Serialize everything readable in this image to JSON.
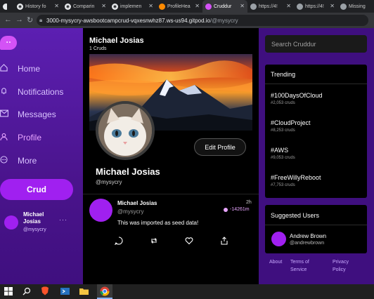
{
  "browser": {
    "tabs": [
      {
        "title": "History fo",
        "icon": "github-icon"
      },
      {
        "title": "Comparin",
        "icon": "github-icon"
      },
      {
        "title": "implemen",
        "icon": "github-icon"
      },
      {
        "title": "ProfileHea",
        "icon": "gitpod-icon"
      },
      {
        "title": "Cruddur",
        "icon": "cruddur-icon",
        "active": true
      },
      {
        "title": "https://4!",
        "icon": "globe-icon"
      },
      {
        "title": "https://4!",
        "icon": "globe-icon"
      },
      {
        "title": "Missing",
        "icon": "globe-icon"
      }
    ],
    "url_host": "3000-mysycry-awsbootcampcrud-vqxesnwhz87.ws-us94.gitpod.io",
    "url_path": "/@mysycry"
  },
  "sidebar": {
    "logo_text": "• •",
    "items": [
      {
        "label": "Home",
        "icon": "home-icon"
      },
      {
        "label": "Notifications",
        "icon": "bell-icon"
      },
      {
        "label": "Messages",
        "icon": "mail-icon"
      },
      {
        "label": "Profile",
        "icon": "person-icon",
        "active": true
      },
      {
        "label": "More",
        "icon": "more-icon"
      }
    ],
    "crud_button": "Crud",
    "user_name": "Michael Josias",
    "user_handle": "@mysycry",
    "more_dots": "···"
  },
  "main": {
    "title": "Michael Josias",
    "subtitle": "1 Cruds",
    "edit_profile": "Edit Profile",
    "display_name": "Michael Josias",
    "handle": "@mysycry",
    "post": {
      "name": "Michael Josias",
      "handle": "@mysycry",
      "time": "2h",
      "expires": "-14261m",
      "text": "This was imported as seed data!"
    }
  },
  "right": {
    "search_placeholder": "Search Cruddur",
    "trending_title": "Trending",
    "trends": [
      {
        "tag": "#100DaysOfCloud",
        "count": "#2,053 cruds"
      },
      {
        "tag": "#CloudProject",
        "count": "#8,253 cruds"
      },
      {
        "tag": "#AWS",
        "count": "#9,053 cruds"
      },
      {
        "tag": "#FreeWillyReboot",
        "count": "#7,753 cruds"
      }
    ],
    "suggested_title": "Suggested Users",
    "suggested_user": {
      "name": "Andrew Brown",
      "handle": "@andrewbrown"
    },
    "footer": {
      "about": "About",
      "terms": "Terms of Service",
      "privacy": "Privacy Policy"
    }
  },
  "colors": {
    "accent": "#a020f0",
    "sidebar": "#4a148c",
    "right": "#3f0f7f",
    "highlight": "#e8a5ff"
  }
}
